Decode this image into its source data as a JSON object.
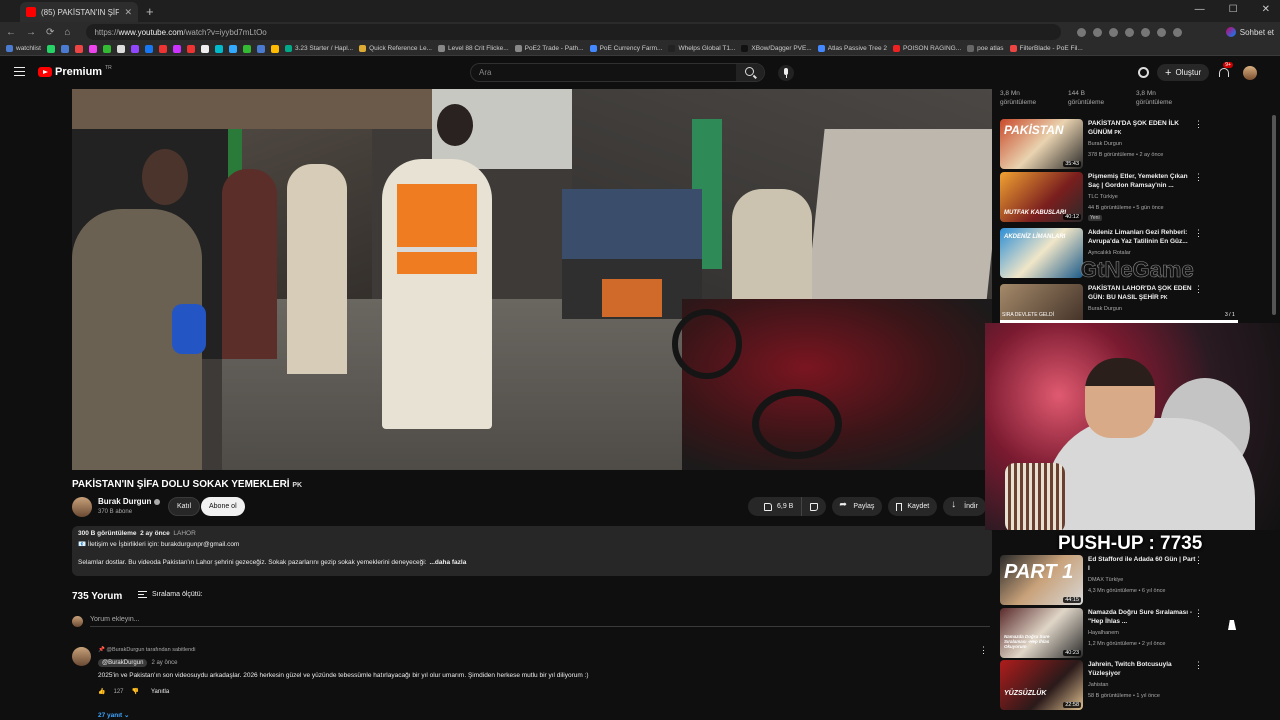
{
  "browser": {
    "tab_title": "(85) PAKİSTAN'IN ŞİFA DOLU",
    "url_prefix": "https://",
    "url_domain": "www.youtube.com",
    "url_path": "/watch?v=iyybd7mLtOo",
    "chat_label": "Sohbet et",
    "bookmarks": [
      "watchlist",
      "3.23 Starter / Hapl...",
      "Quick Reference Le...",
      "Level 88 Crit Flicke...",
      "PoE2 Trade - Path...",
      "PoE Currency Farm...",
      "Whelps Global T1...",
      "XBow/Dagger PVE...",
      "Atlas Passive Tree 2",
      "POISON RAGING...",
      "poe atlas",
      "FilterBlade - PoE Fil..."
    ]
  },
  "header": {
    "logo_text": "Premium",
    "logo_region": "TR",
    "search_placeholder": "Ara",
    "create_label": "Oluştur",
    "notif_badge": "9+"
  },
  "video": {
    "title": "PAKİSTAN'IN ŞİFA DOLU SOKAK YEMEKLERİ",
    "title_badge": "PK",
    "channel": "Burak Durgun",
    "subscribers": "370 B abone",
    "join_label": "Katıl",
    "subscribe_label": "Abone ol",
    "likes": "6,9 B",
    "share_label": "Paylaş",
    "save_label": "Kaydet",
    "download_label": "İndir",
    "more": "···"
  },
  "description": {
    "views": "300 B görüntüleme",
    "age": "2 ay önce",
    "location": "LAHOR",
    "contact": "📧 İletişim ve İşbirlikleri için: burakdurgunpr@gmail.com",
    "text": "Selamlar dostlar. Bu videoda Pakistan'ın Lahor şehrini gezeceğiz. Sokak pazarlarını gezip sokak yemeklerini deneyeceği:",
    "more_label": "...daha fazla"
  },
  "comments": {
    "count": "735 Yorum",
    "sort_label": "Sıralama ölçütü:",
    "add_placeholder": "Yorum ekleyin...",
    "pinned": "@BurakDurgun tarafından sabitlendi",
    "author": "@BurakDurgun",
    "date": "2 ay önce",
    "text": "2025'in ve Pakistan'ın son videosuydu arkadaşlar. 2026 herkesin güzel ve yüzünde tebessümle hatırlayacağı bir yıl olur umarım. Şimdiden herkese mutlu bir yıl diliyorum :)",
    "likes": "127",
    "reply_label": "Yanıtla",
    "replies_label": "27 yanıt"
  },
  "sidebar": {
    "top_views": [
      "3,8 Mn görüntüleme",
      "144 B görüntüleme",
      "3,8 Mn görüntüleme"
    ],
    "items": [
      {
        "title": "PAKİSTAN'DA ŞOK EDEN İLK GÜNÜM",
        "badge": "PK",
        "channel": "Burak Durgun",
        "meta": "378 B görüntüleme • 2 ay önce",
        "duration": "35:43",
        "thumb_text": "PAKİSTAN",
        "new": ""
      },
      {
        "title": "Pişmemiş Etler, Yemekten Çıkan Saç | Gordon Ramsay'nin ...",
        "badge": "",
        "channel": "TLC Türkiye",
        "meta": "44 B görüntüleme • 5 gün önce",
        "duration": "40:12",
        "thumb_text": "MUTFAK KABUSLARI",
        "new": "Yeni"
      },
      {
        "title": "Akdeniz Limanları Gezi Rehberi: Avrupa'da Yaz Tatilinin En Güz...",
        "badge": "",
        "channel": "Ayncalıklı Rotalar",
        "meta": "",
        "duration": "",
        "thumb_text": "AKDENİZ LİMANLARI",
        "new": ""
      },
      {
        "title": "PAKİSTAN LAHOR'DA ŞOK EDEN GÜN: BU NASIL ŞEHİR",
        "badge": "PK",
        "channel": "Burak Durgun",
        "meta": "",
        "duration": "",
        "thumb_text": "",
        "new": ""
      },
      {
        "title": "Ed Stafford ile Adada 60 Gün | Part I",
        "badge": "",
        "channel": "DMAX Türkiye",
        "meta": "4,3 Mn görüntüleme • 6 yıl önce",
        "duration": "44:15",
        "thumb_text": "PART 1",
        "new": ""
      },
      {
        "title": "Namazda Doğru Sure Sıralaması - \"Hep İhlas ...",
        "badge": "",
        "channel": "Hayalhanem",
        "meta": "1,2 Mn görüntüleme • 2 yıl önce",
        "duration": "40:23",
        "thumb_text": "Namazda Doğru Sure Sıralaması -Hep İhlas Okuyorum",
        "new": ""
      },
      {
        "title": "Jahrein, Twitch Botcusuyla Yüzleşiyor",
        "badge": "",
        "channel": "Jahistan",
        "meta": "58 B görüntüleme • 1 yıl önce",
        "duration": "22:58",
        "thumb_text": "YÜZSÜZLÜK",
        "new": ""
      }
    ]
  },
  "overlay": {
    "pushup": "PUSH-UP : 7735",
    "game_watermark": "GtNeGame",
    "bar_label": "SIRA DEVLETE GELDİ",
    "bar_count": "3 / 1"
  }
}
